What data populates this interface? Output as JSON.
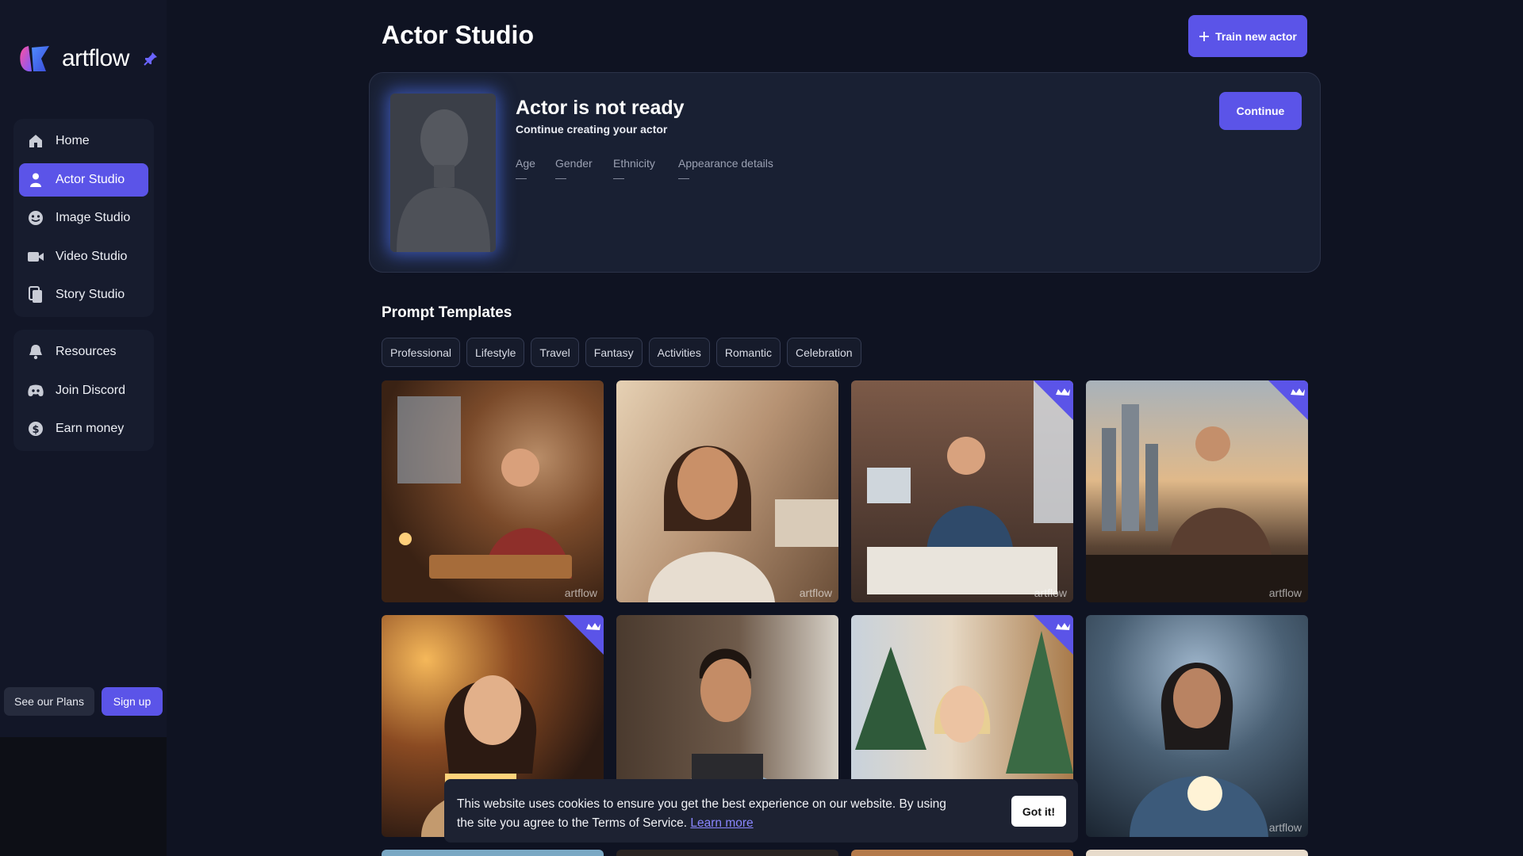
{
  "brand": {
    "name": "artflow",
    "accent": "#5b54e8",
    "icon": "artflow-logo"
  },
  "sidebar": {
    "primary": [
      {
        "label": "Home",
        "icon": "home-icon"
      },
      {
        "label": "Actor Studio",
        "icon": "person-icon",
        "active": true
      },
      {
        "label": "Image Studio",
        "icon": "image-studio-icon"
      },
      {
        "label": "Video Studio",
        "icon": "video-camera-icon"
      },
      {
        "label": "Story Studio",
        "icon": "story-book-icon"
      }
    ],
    "secondary": [
      {
        "label": "Resources",
        "icon": "bell-icon"
      },
      {
        "label": "Join Discord",
        "icon": "discord-icon"
      },
      {
        "label": "Earn money",
        "icon": "dollar-icon"
      }
    ],
    "plans_label": "See our Plans",
    "signup_label": "Sign up"
  },
  "header": {
    "title": "Actor Studio",
    "train_label": "Train new actor"
  },
  "actor": {
    "status": "Actor is not ready",
    "subtitle": "Continue creating your actor",
    "continue_label": "Continue",
    "attributes": [
      {
        "label": "Age",
        "value": "—"
      },
      {
        "label": "Gender",
        "value": "—"
      },
      {
        "label": "Ethnicity",
        "value": "—"
      },
      {
        "label": "Appearance details",
        "value": "—"
      }
    ]
  },
  "templates": {
    "title": "Prompt Templates",
    "chips": [
      "Professional",
      "Lifestyle",
      "Travel",
      "Fantasy",
      "Activities",
      "Romantic",
      "Celebration"
    ],
    "watermark": "artflow",
    "tiles": [
      {
        "name": "baker-woman-kitchen",
        "premium": false
      },
      {
        "name": "woman-living-room-portrait",
        "premium": false
      },
      {
        "name": "man-desk-office",
        "premium": true
      },
      {
        "name": "businessman-city-window",
        "premium": true
      },
      {
        "name": "woman-gift-bokeh",
        "premium": true
      },
      {
        "name": "barista-man-apron",
        "premium": false
      },
      {
        "name": "woman-christmas-tree",
        "premium": true
      },
      {
        "name": "mystic-woman-crystal-orb",
        "premium": false
      }
    ]
  },
  "cookie": {
    "text": "This website uses cookies to ensure you get the best experience on our website. By using the site you agree to the Terms of Service.",
    "link_label": "Learn more",
    "button_label": "Got it!"
  }
}
